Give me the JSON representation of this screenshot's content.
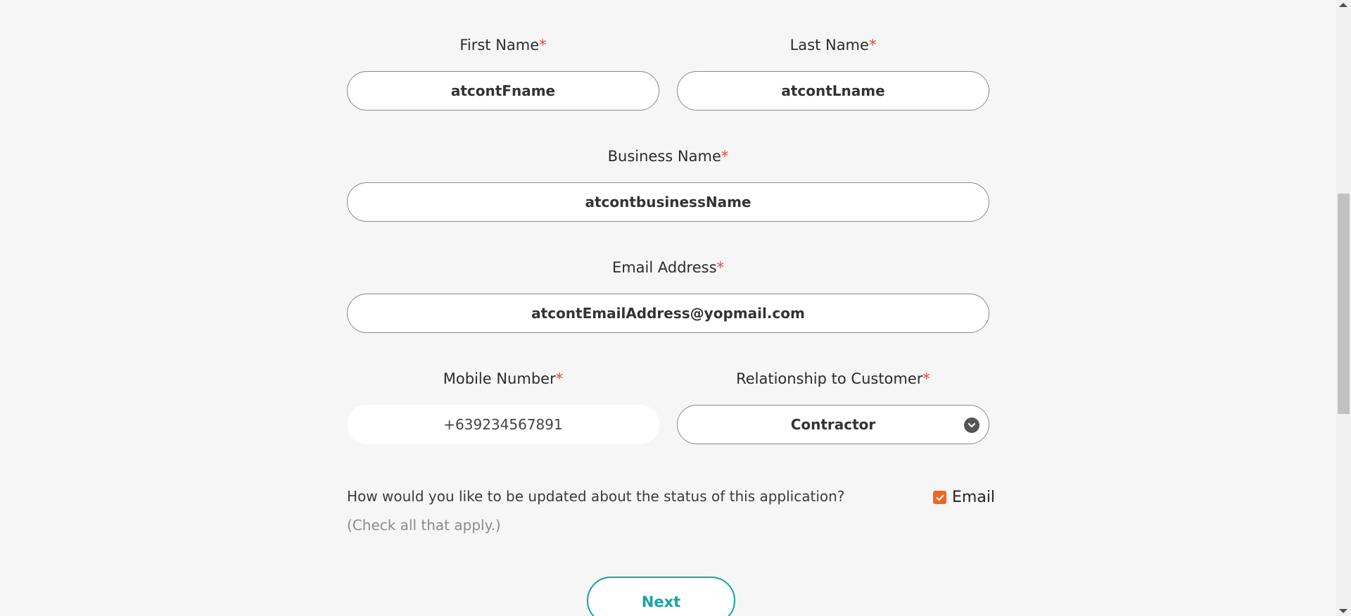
{
  "form": {
    "first_name": {
      "label": "First Name",
      "required_mark": "*",
      "value": "atcontFname"
    },
    "last_name": {
      "label": "Last Name",
      "required_mark": "*",
      "value": "atcontLname"
    },
    "business_name": {
      "label": "Business Name",
      "required_mark": "*",
      "value": "atcontbusinessName"
    },
    "email": {
      "label": "Email Address",
      "required_mark": "*",
      "value": "atcontEmailAddress@yopmail.com"
    },
    "mobile": {
      "label": "Mobile Number",
      "required_mark": "*",
      "value": "+639234567891"
    },
    "relationship": {
      "label": "Relationship to Customer",
      "required_mark": "*",
      "selected": "Contractor"
    },
    "updates": {
      "question": "How would you like to be updated about the status of this application?",
      "hint": "(Check all that apply.)",
      "options": [
        {
          "label": "Email",
          "checked": true
        }
      ]
    },
    "next_label": "Next"
  },
  "colors": {
    "accent": "#16a3a3",
    "required": "#e5483b",
    "checkbox": "#f26522",
    "background": "#f6f6f6"
  },
  "icons": {
    "select_arrow": "chevron-down-circle-icon",
    "checkbox": "checkmark-icon"
  }
}
